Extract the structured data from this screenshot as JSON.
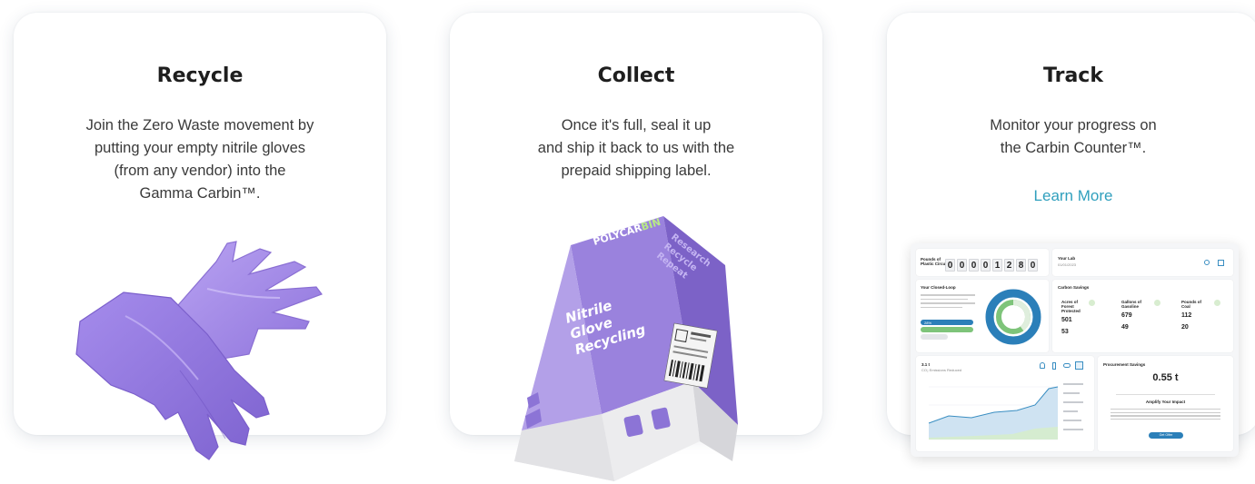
{
  "cards": [
    {
      "title": "Recycle",
      "body": "Join the Zero Waste movement by\nputting your empty nitrile gloves\n(from any vendor) into the\nGamma Carbin™."
    },
    {
      "title": "Collect",
      "body": "Once it's full, seal it up\nand ship it back to us with the\nprepaid shipping label."
    },
    {
      "title": "Track",
      "body": "Monitor your progress on\nthe Carbin Counter™.",
      "link": "Learn More"
    }
  ],
  "box": {
    "brand_a": "POLYCAR",
    "brand_b": "BIN",
    "side": [
      "Research",
      "Recycle",
      "Repeat"
    ],
    "front": [
      "Nitrile",
      "Glove",
      "Recycling"
    ]
  },
  "dashboard": {
    "counter_label": [
      "Pounds of",
      "Plastic Circulated"
    ],
    "counter_digits": [
      "0",
      "0",
      "0",
      "0",
      "1",
      "2",
      "8",
      "0"
    ],
    "lab_title": "Your Lab",
    "lab_date": "01/01/2023",
    "loop_title": "Your Closed-Loop",
    "loop_pct": "28%",
    "carbon_title": "Carbon Savings",
    "stats": [
      {
        "label": "Acres of Forest Protected",
        "value": "501",
        "value2": "53"
      },
      {
        "label": "Gallons of Gasoline",
        "value": "679",
        "value2": "49"
      },
      {
        "label": "Pounds of Coal",
        "value": "112",
        "value2": "20"
      }
    ],
    "chart_title": "3.1 t",
    "chart_sub": "CO₂ Emissions Reduced",
    "procure_title": "Procurement Savings",
    "procure_value": "0.55 t",
    "amplify_title": "Amplify Your Impact",
    "amplify_button": "Get Offer"
  }
}
